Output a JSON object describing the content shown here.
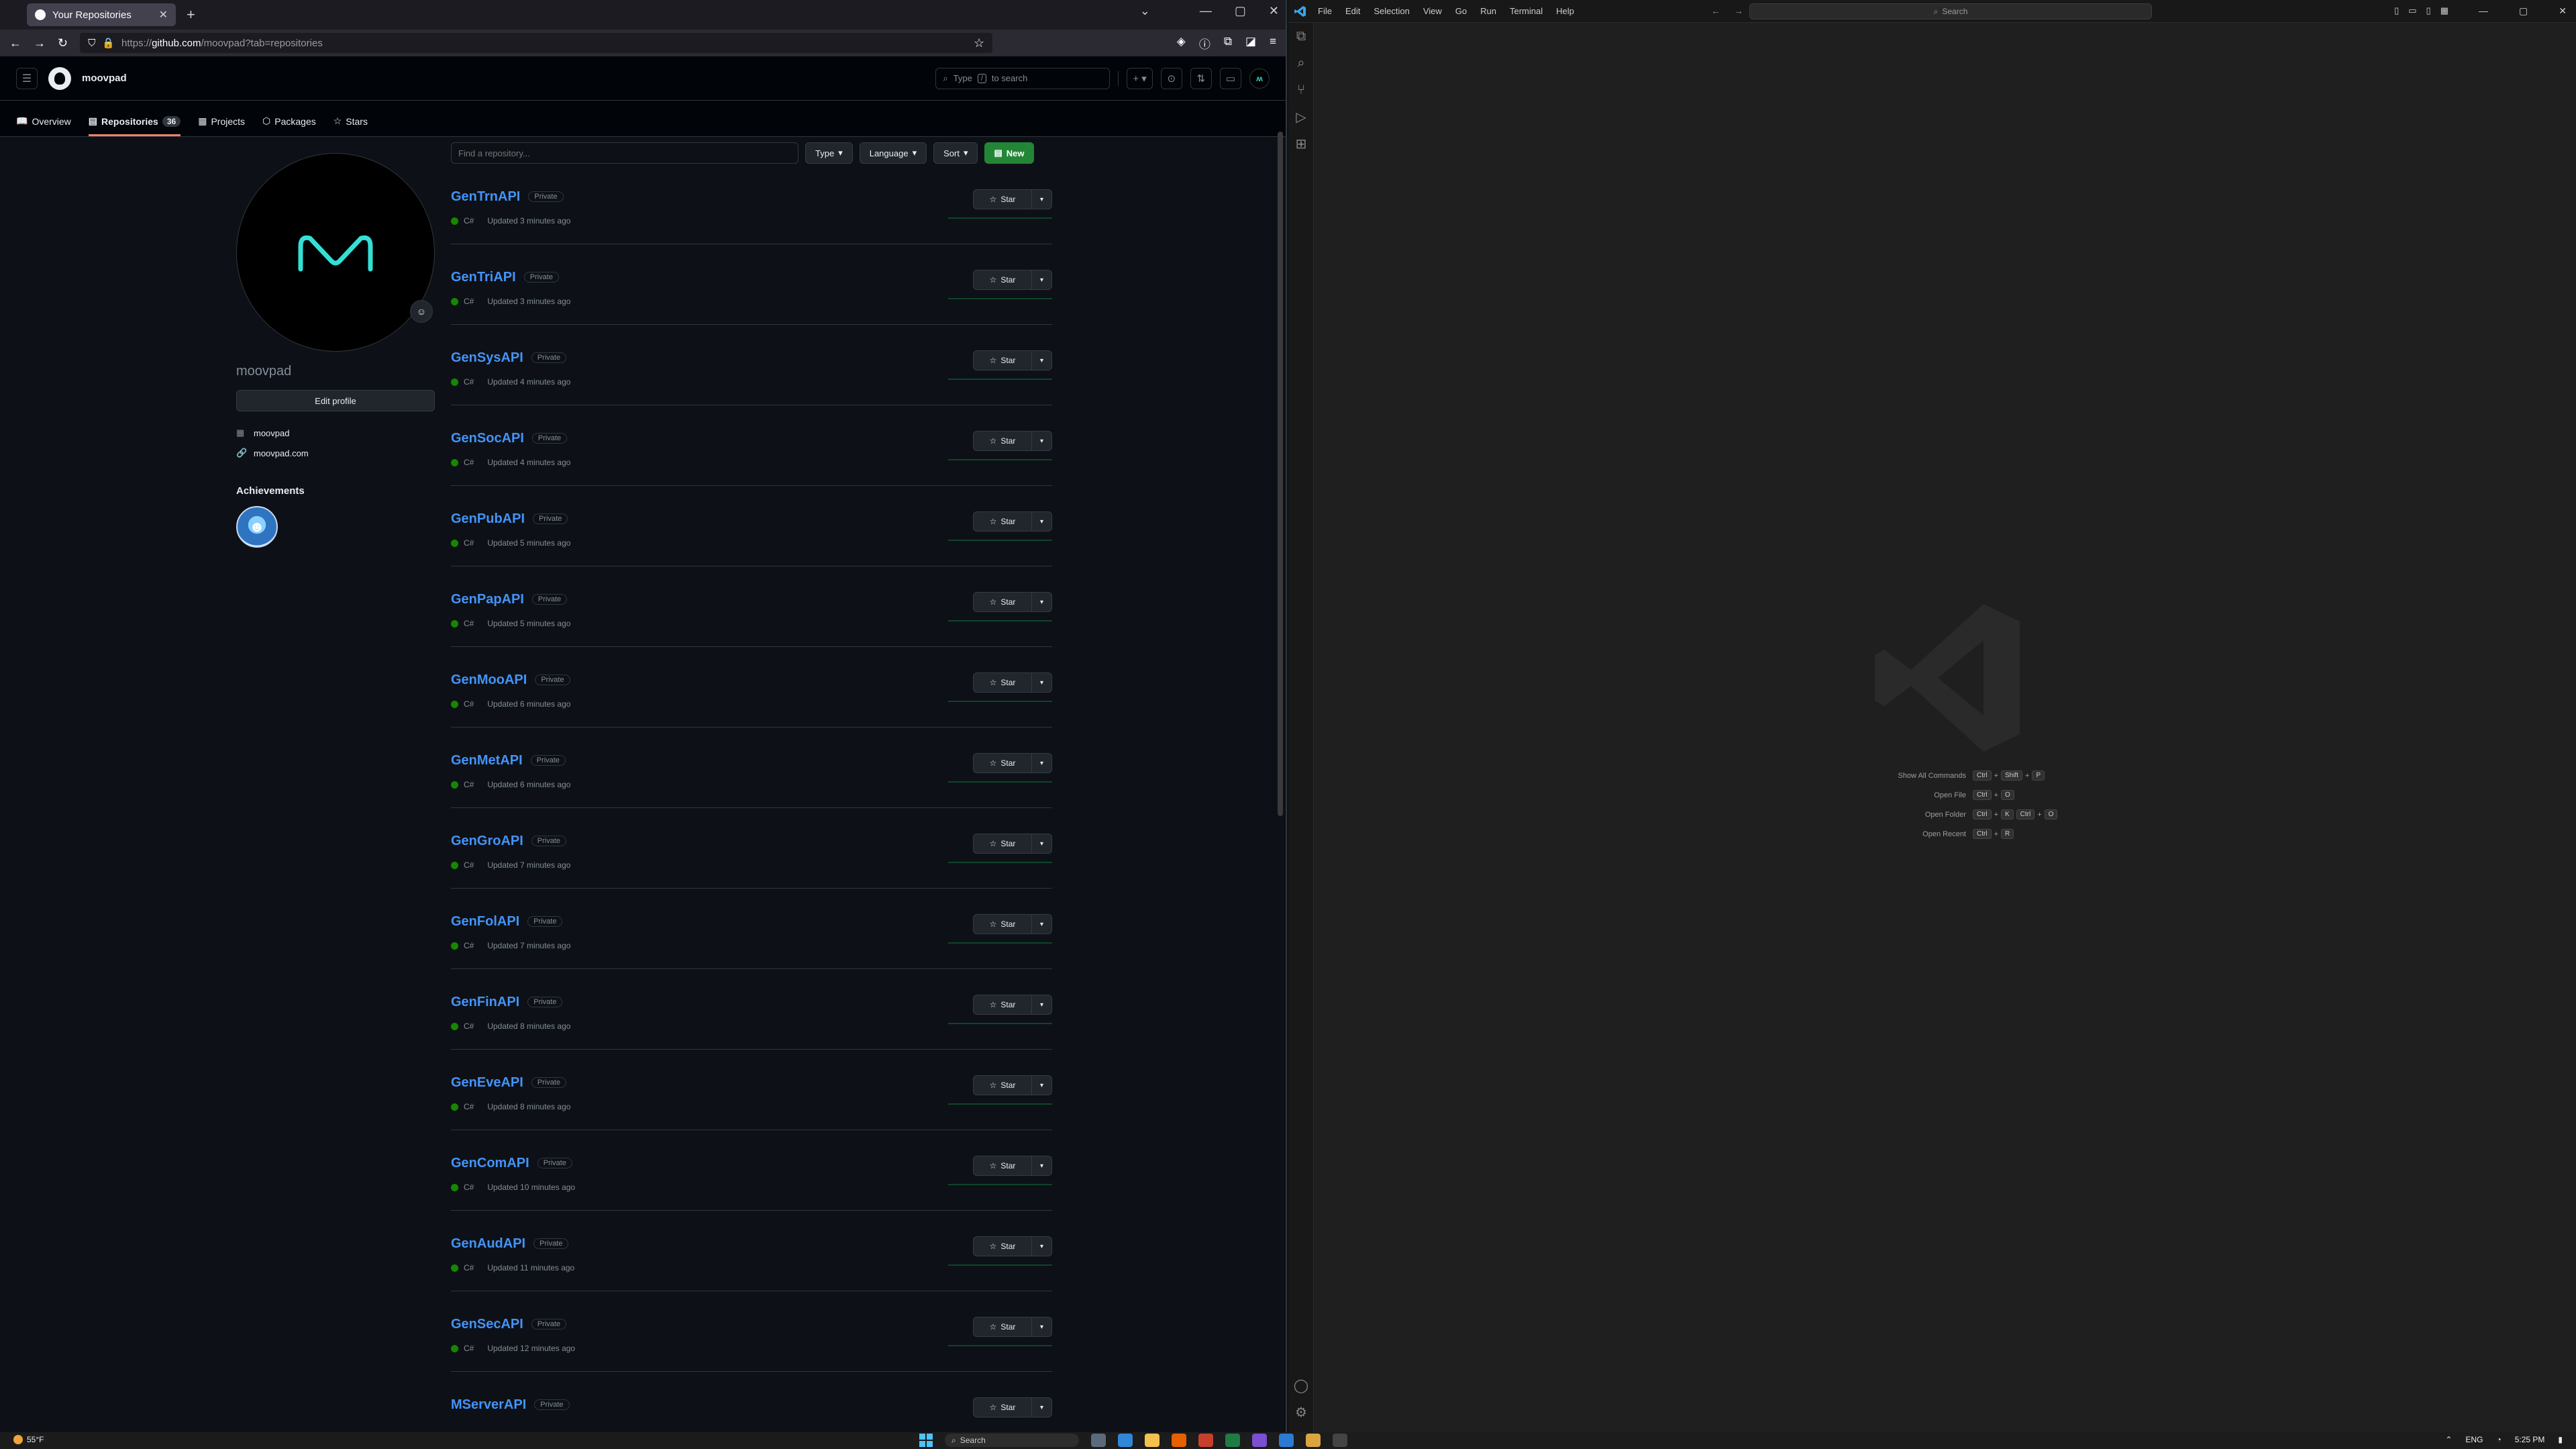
{
  "browser": {
    "tab_title": "Your Repositories",
    "url_scheme": "https://",
    "url_host": "github.com",
    "url_path": "/moovpad?tab=repositories"
  },
  "github": {
    "username": "moovpad",
    "search_placeholder_pre": "Type",
    "search_key": "/",
    "search_placeholder_post": "to search",
    "nav": {
      "overview": "Overview",
      "repositories": "Repositories",
      "repo_count": "36",
      "projects": "Projects",
      "packages": "Packages",
      "stars": "Stars"
    },
    "profile": {
      "name": "moovpad",
      "edit_label": "Edit profile",
      "org": "moovpad",
      "website": "moovpad.com",
      "achievements_title": "Achievements"
    },
    "filters": {
      "find_placeholder": "Find a repository...",
      "type": "Type",
      "language": "Language",
      "sort": "Sort",
      "new": "New"
    },
    "star_label": "Star",
    "repos": [
      {
        "name": "GenTrnAPI",
        "visibility": "Private",
        "language": "C#",
        "updated": "Updated 3 minutes ago"
      },
      {
        "name": "GenTriAPI",
        "visibility": "Private",
        "language": "C#",
        "updated": "Updated 3 minutes ago"
      },
      {
        "name": "GenSysAPI",
        "visibility": "Private",
        "language": "C#",
        "updated": "Updated 4 minutes ago"
      },
      {
        "name": "GenSocAPI",
        "visibility": "Private",
        "language": "C#",
        "updated": "Updated 4 minutes ago"
      },
      {
        "name": "GenPubAPI",
        "visibility": "Private",
        "language": "C#",
        "updated": "Updated 5 minutes ago"
      },
      {
        "name": "GenPapAPI",
        "visibility": "Private",
        "language": "C#",
        "updated": "Updated 5 minutes ago"
      },
      {
        "name": "GenMooAPI",
        "visibility": "Private",
        "language": "C#",
        "updated": "Updated 6 minutes ago"
      },
      {
        "name": "GenMetAPI",
        "visibility": "Private",
        "language": "C#",
        "updated": "Updated 6 minutes ago"
      },
      {
        "name": "GenGroAPI",
        "visibility": "Private",
        "language": "C#",
        "updated": "Updated 7 minutes ago"
      },
      {
        "name": "GenFolAPI",
        "visibility": "Private",
        "language": "C#",
        "updated": "Updated 7 minutes ago"
      },
      {
        "name": "GenFinAPI",
        "visibility": "Private",
        "language": "C#",
        "updated": "Updated 8 minutes ago"
      },
      {
        "name": "GenEveAPI",
        "visibility": "Private",
        "language": "C#",
        "updated": "Updated 8 minutes ago"
      },
      {
        "name": "GenComAPI",
        "visibility": "Private",
        "language": "C#",
        "updated": "Updated 10 minutes ago"
      },
      {
        "name": "GenAudAPI",
        "visibility": "Private",
        "language": "C#",
        "updated": "Updated 11 minutes ago"
      },
      {
        "name": "GenSecAPI",
        "visibility": "Private",
        "language": "C#",
        "updated": "Updated 12 minutes ago"
      },
      {
        "name": "MServerAPI",
        "visibility": "Private",
        "language": "",
        "updated": ""
      }
    ],
    "colors": {
      "link": "#4493f8",
      "csharp": "#178600",
      "new_button": "#238636",
      "active_tab": "#f78166"
    }
  },
  "vscode": {
    "menu": [
      "File",
      "Edit",
      "Selection",
      "View",
      "Go",
      "Run",
      "Terminal",
      "Help"
    ],
    "search": "Search",
    "shortcuts": [
      {
        "label": "Show All Commands",
        "keys": [
          "Ctrl",
          "+",
          "Shift",
          "+",
          "P"
        ]
      },
      {
        "label": "Open File",
        "keys": [
          "Ctrl",
          "+",
          "O"
        ]
      },
      {
        "label": "Open Folder",
        "keys": [
          "Ctrl",
          "+",
          "K",
          "Ctrl",
          "+",
          "O"
        ]
      },
      {
        "label": "Open Recent",
        "keys": [
          "Ctrl",
          "+",
          "R"
        ]
      }
    ]
  },
  "taskbar": {
    "temperature": "55°F",
    "search": "Search",
    "language": "ENG",
    "time": "5:25 PM"
  }
}
